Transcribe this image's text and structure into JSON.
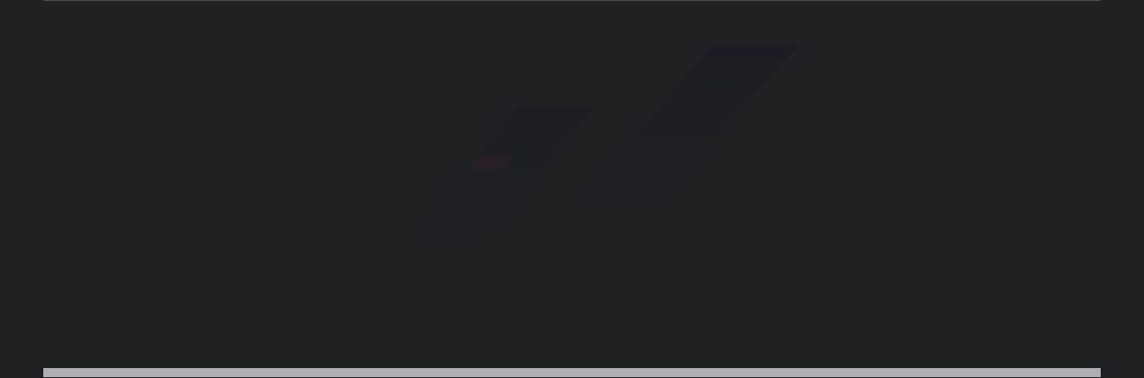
{
  "window": {
    "background_color": "#202123",
    "rule_color": "#4a4b4f",
    "scrollbar_color": "#aeaeb3"
  },
  "watermark": {
    "icon": "brand-logo-watermark"
  }
}
